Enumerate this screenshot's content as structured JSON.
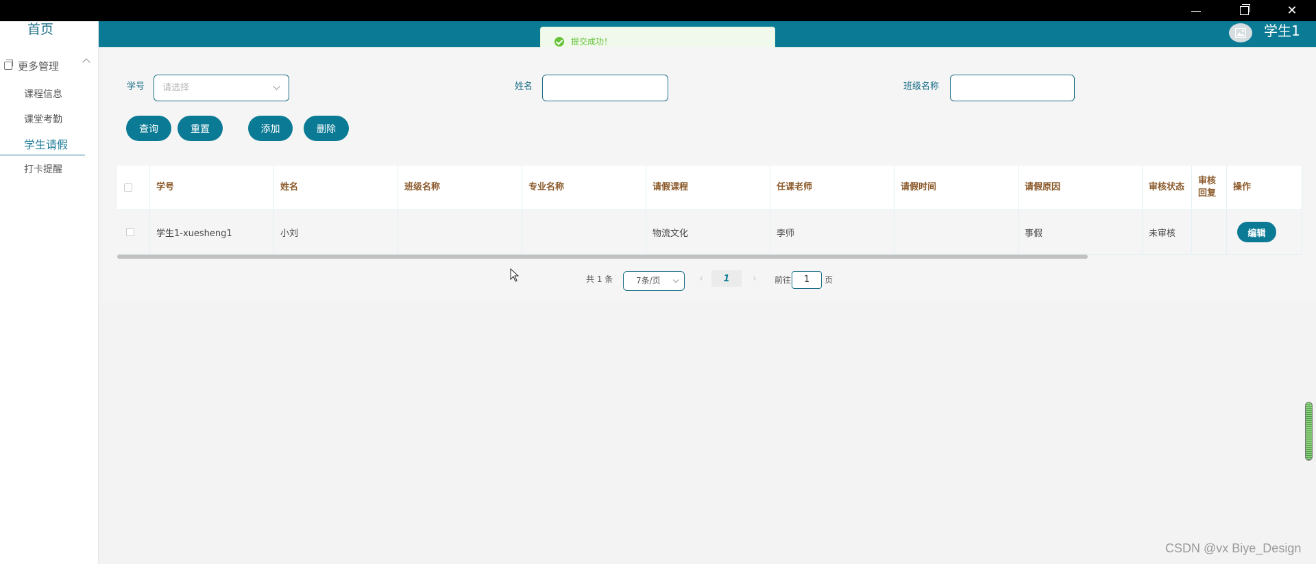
{
  "sidebar": {
    "home": "首页",
    "group_label": "更多管理",
    "items": [
      {
        "label": "课程信息",
        "active": false
      },
      {
        "label": "课堂考勤",
        "active": false
      },
      {
        "label": "学生请假",
        "active": true
      },
      {
        "label": "打卡提醒",
        "active": false
      }
    ]
  },
  "header": {
    "user_name": "学生1",
    "avatar_icon": "image-icon",
    "color": "#0b7b95"
  },
  "toast": {
    "message": "提交成功！",
    "status_color": "#67c23a"
  },
  "search": {
    "student_no_label": "学号",
    "student_no_placeholder": "请选择",
    "name_label": "姓名",
    "name_value": "",
    "class_label": "班级名称",
    "class_value": ""
  },
  "buttons": {
    "query": "查询",
    "reset": "重置",
    "add": "添加",
    "delete": "删除"
  },
  "table": {
    "headers": [
      "学号",
      "姓名",
      "班级名称",
      "专业名称",
      "请假课程",
      "任课老师",
      "请假时间",
      "请假原因",
      "审核状态",
      "审核回复",
      "操作"
    ],
    "rows": [
      {
        "student_no": "学生1-xuesheng1",
        "name": "小刘",
        "class_name": "",
        "major_name": "",
        "course": "物流文化",
        "teacher": "李师",
        "leave_time": "",
        "reason": "事假",
        "review_status": "未审核",
        "review_reply": "",
        "action": "编辑"
      }
    ]
  },
  "pagination": {
    "total": "共 1 条",
    "page_size": "7条/页",
    "current_page": "1",
    "goto_label": "前往",
    "goto_value": "1",
    "page_suffix": "页"
  },
  "watermark": "CSDN @vx  Biye_Design",
  "colors": {
    "accent": "#0b7b95",
    "header_text": "#8b5a2b",
    "success": "#67c23a"
  }
}
